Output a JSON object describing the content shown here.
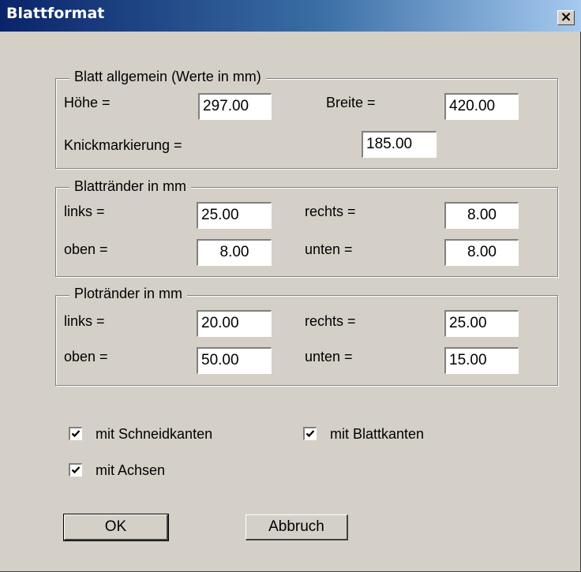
{
  "window": {
    "title": "Blattformat",
    "close_label": "×"
  },
  "blatt_allgemein": {
    "legend": "Blatt allgemein (Werte in mm)",
    "hoehe_label": "Höhe =",
    "hoehe_value": "297.00",
    "breite_label": "Breite =",
    "breite_value": "420.00",
    "knick_label": "Knickmarkierung =",
    "knick_value": "185.00"
  },
  "blattraender": {
    "legend": "Blattränder in mm",
    "links_label": "links =",
    "links_value": "25.00",
    "rechts_label": "rechts =",
    "rechts_value": "8.00",
    "oben_label": "oben =",
    "oben_value": "8.00",
    "unten_label": "unten =",
    "unten_value": "8.00"
  },
  "plotraender": {
    "legend": "Plotränder in mm",
    "links_label": "links =",
    "links_value": "20.00",
    "rechts_label": "rechts =",
    "rechts_value": "25.00",
    "oben_label": "oben =",
    "oben_value": "50.00",
    "unten_label": "unten =",
    "unten_value": "15.00"
  },
  "options": {
    "schneidkanten": {
      "label": "mit Schneidkanten",
      "checked": true
    },
    "blattkanten": {
      "label": "mit Blattkanten",
      "checked": true
    },
    "achsen": {
      "label": "mit Achsen",
      "checked": true
    }
  },
  "buttons": {
    "ok": "OK",
    "cancel": "Abbruch"
  }
}
